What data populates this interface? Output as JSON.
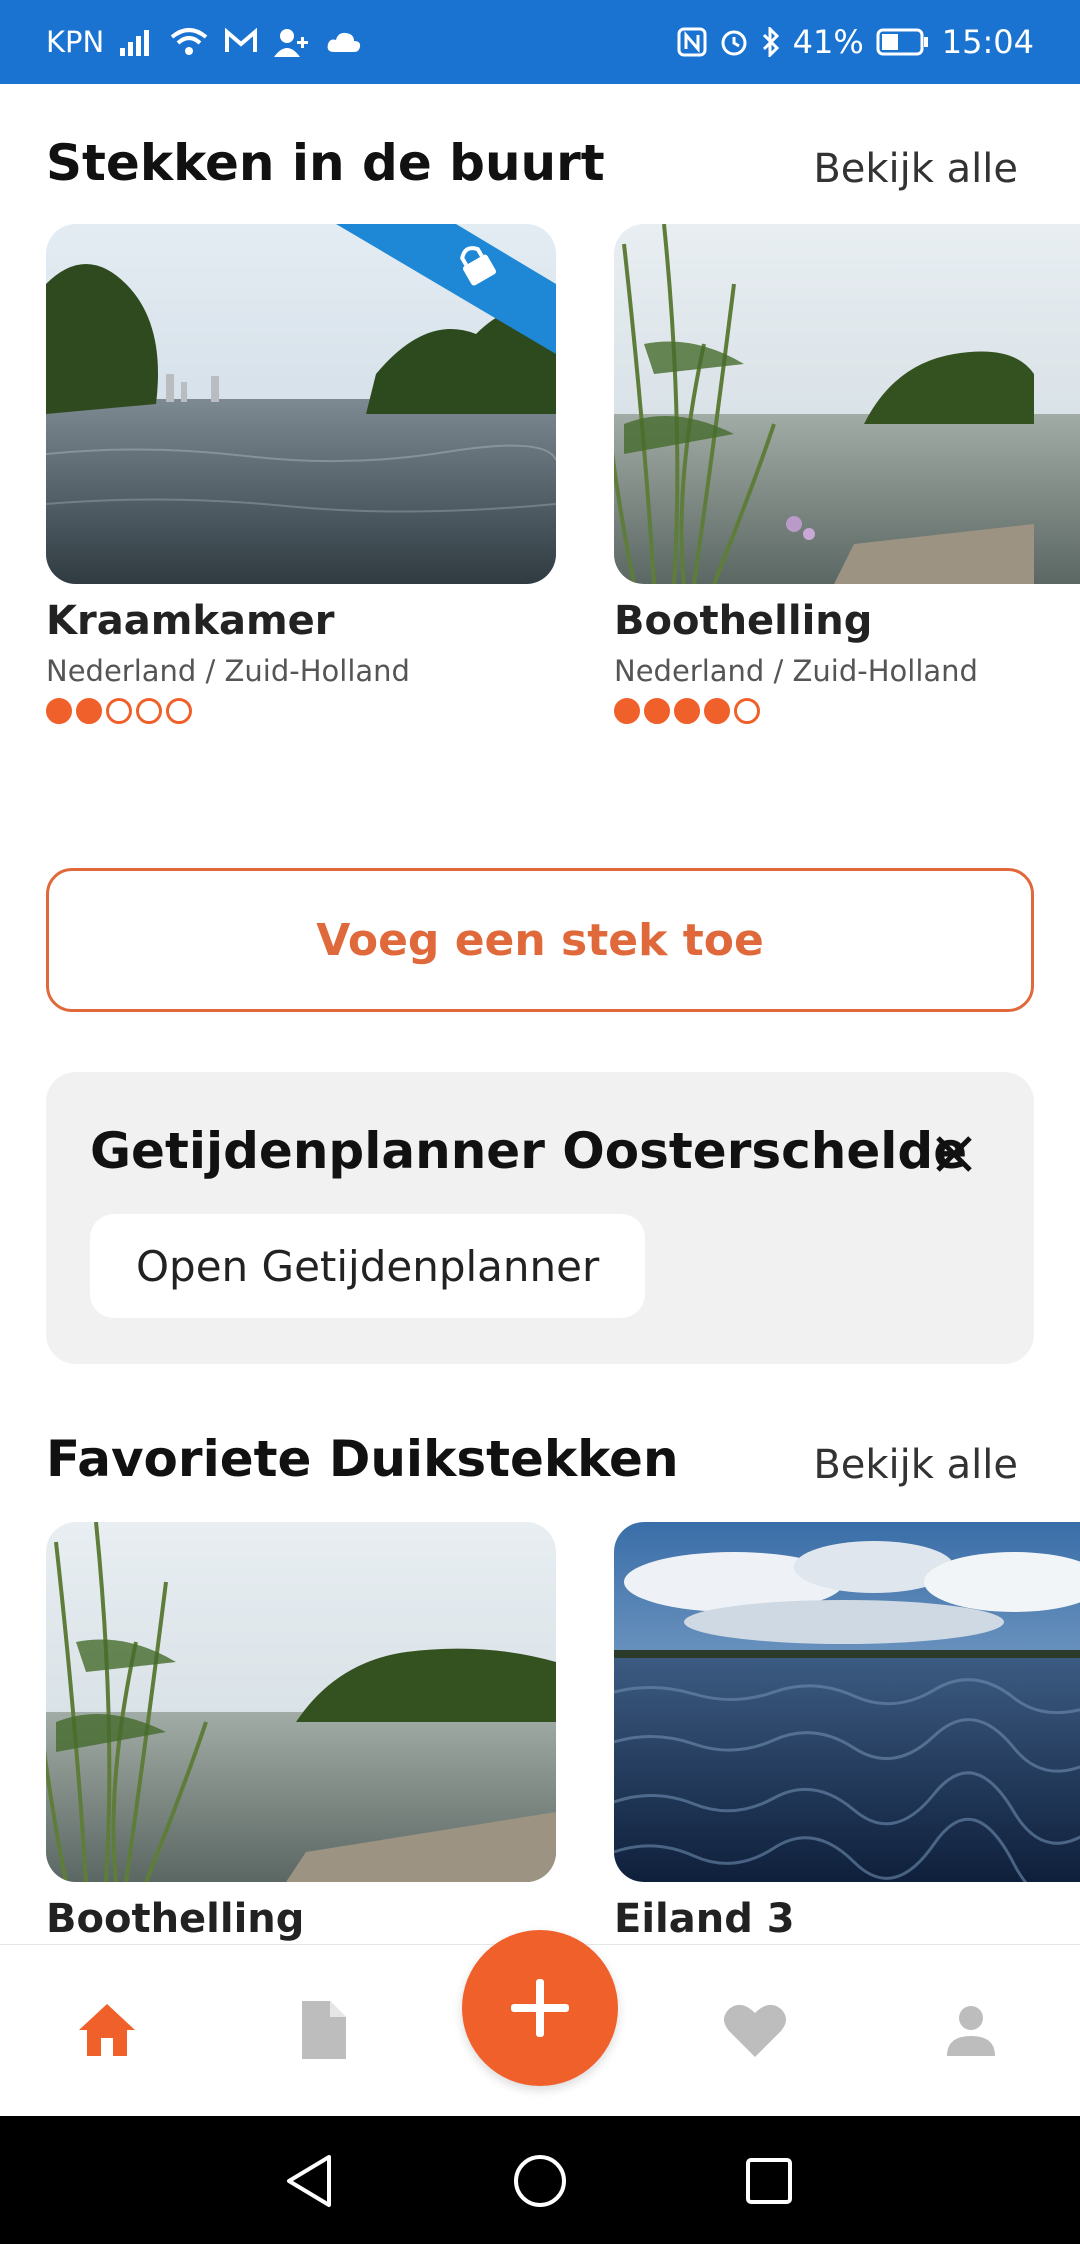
{
  "status_bar": {
    "carrier": "KPN",
    "battery": "41%",
    "time": "15:04"
  },
  "nearby": {
    "title": "Stekken in de buurt",
    "see_all": "Bekijk alle",
    "cards": [
      {
        "name": "Kraamkamer",
        "region": "Nederland / Zuid-Holland",
        "rating": 2,
        "max_rating": 5,
        "locked": true
      },
      {
        "name": "Boothelling",
        "region": "Nederland / Zuid-Holland",
        "rating": 4,
        "max_rating": 5,
        "locked": false
      }
    ]
  },
  "add_spot": {
    "label": "Voeg een stek toe"
  },
  "tide_planner": {
    "title": "Getijdenplanner Oosterschelde",
    "open_label": "Open Getijdenplanner"
  },
  "favorites": {
    "title": "Favoriete Duikstekken",
    "see_all": "Bekijk alle",
    "cards": [
      {
        "name": "Boothelling"
      },
      {
        "name": "Eiland 3"
      }
    ]
  },
  "colors": {
    "accent": "#f0602a",
    "status_bar": "#1a73d1",
    "ribbon": "#1e88d6",
    "nav_inactive": "#bdbdbd"
  },
  "bottom_nav": {
    "items": [
      {
        "icon": "home-icon",
        "active": true
      },
      {
        "icon": "document-icon",
        "active": false
      },
      {
        "icon": "add-icon",
        "active": false
      },
      {
        "icon": "heart-icon",
        "active": false
      },
      {
        "icon": "person-icon",
        "active": false
      }
    ]
  }
}
